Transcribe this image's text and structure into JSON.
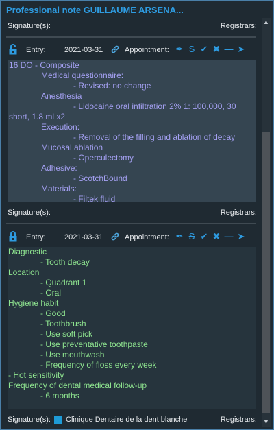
{
  "title": "Professional note GUILLAUME ARSENA...",
  "top_signature": {
    "signatures_label": "Signature(s):",
    "registrars_label": "Registrars:"
  },
  "entries": [
    {
      "entry_label": "Entry:",
      "date": "2021-03-31",
      "appointment_label": "Appointment:",
      "lines": [
        {
          "indent": 0,
          "text": "16 DO - Composite"
        },
        {
          "indent": 1,
          "text": "Medical questionnaire:"
        },
        {
          "indent": 2,
          "text": "- Revised: no change"
        },
        {
          "indent": 1,
          "text": "Anesthesia"
        },
        {
          "indent": 2,
          "text": "- Lidocaine oral infiltration 2% 1: 100,000, 30"
        },
        {
          "indent": 0,
          "text": "short, 1.8 ml x2"
        },
        {
          "indent": 1,
          "text": "Execution:"
        },
        {
          "indent": 2,
          "text": "- Removal of the filling and ablation of decay"
        },
        {
          "indent": 1,
          "text": "Mucosal ablation"
        },
        {
          "indent": 2,
          "text": "- Operculectomy"
        },
        {
          "indent": 1,
          "text": "Adhesive:"
        },
        {
          "indent": 2,
          "text": "- ScotchBound"
        },
        {
          "indent": 1,
          "text": "Materials:"
        },
        {
          "indent": 2,
          "text": "- Filtek fluid"
        }
      ],
      "signatures_label": "Signature(s):",
      "registrars_label": "Registrars:"
    },
    {
      "entry_label": "Entry:",
      "date": "2021-03-31",
      "appointment_label": "Appointment:",
      "lines": [
        {
          "indent": 0,
          "text": "Diagnostic"
        },
        {
          "indent": 2,
          "text": "- Tooth decay"
        },
        {
          "indent": 0,
          "text": "Location"
        },
        {
          "indent": 2,
          "text": "- Quadrant 1"
        },
        {
          "indent": 2,
          "text": "- Oral"
        },
        {
          "indent": 0,
          "text": "Hygiene habit"
        },
        {
          "indent": 2,
          "text": "- Good"
        },
        {
          "indent": 2,
          "text": "- Toothbrush"
        },
        {
          "indent": 2,
          "text": "- Use soft pick"
        },
        {
          "indent": 2,
          "text": "- Use preventative toothpaste"
        },
        {
          "indent": 2,
          "text": "- Use mouthwash"
        },
        {
          "indent": 2,
          "text": "- Frequency of floss every week"
        },
        {
          "indent": 0,
          "text": "- Hot sensitivity"
        },
        {
          "indent": 0,
          "text": "Frequency of dental medical follow-up"
        },
        {
          "indent": 2,
          "text": "- 6 months"
        }
      ],
      "signatures_label": "Signature(s):",
      "clinic_name": "Clinique Dentaire  de la dent blanche",
      "registrars_label": "Registrars:"
    }
  ],
  "colors": {
    "accent": "#2e9be0",
    "note1_text": "#a4a0f2",
    "note2_text": "#8ee38f"
  },
  "icons": [
    "lock-icon",
    "link-icon",
    "sign-icon",
    "strikethrough-icon",
    "check-icon",
    "close-icon",
    "minus-icon",
    "pin-icon"
  ]
}
